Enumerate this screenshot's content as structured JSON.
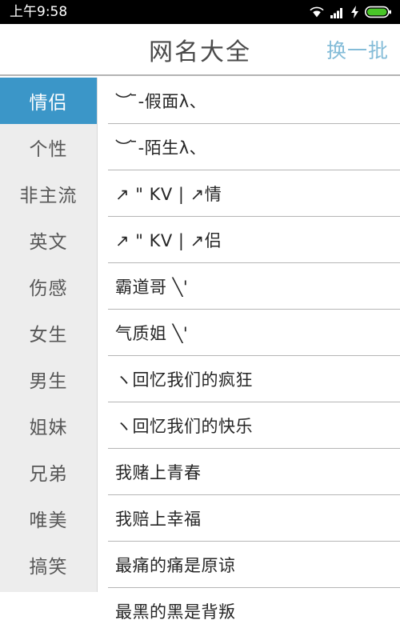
{
  "statusbar": {
    "time": "上午9:58",
    "icons": [
      {
        "name": "wifi-icon"
      },
      {
        "name": "signal-bars-icon"
      },
      {
        "name": "charging-bolt-icon"
      },
      {
        "name": "battery-icon"
      }
    ],
    "battery_color": "#49c628",
    "background": "#000000"
  },
  "header": {
    "title": "网名大全",
    "action_label": "换一批",
    "action_color": "#84bcd8",
    "title_color": "#4a4a4a"
  },
  "sidebar": {
    "active_index": 0,
    "active_bg": "#3b96c8",
    "bg": "#ededed",
    "items": [
      {
        "label": "情侣"
      },
      {
        "label": "个性"
      },
      {
        "label": "非主流"
      },
      {
        "label": "英文"
      },
      {
        "label": "伤感"
      },
      {
        "label": "女生"
      },
      {
        "label": "男生"
      },
      {
        "label": "姐妹"
      },
      {
        "label": "兄弟"
      },
      {
        "label": "唯美"
      },
      {
        "label": "搞笑"
      }
    ]
  },
  "list": {
    "rows": [
      {
        "text": "︶ ̄-假面λ、"
      },
      {
        "text": "︶ ̄-陌生λ、"
      },
      {
        "text": "↗ \" KV | ↗情"
      },
      {
        "text": "↗ \" KV | ↗侣"
      },
      {
        "text": "霸道哥 ╲'"
      },
      {
        "text": "气质姐 ╲'"
      },
      {
        "text": "ヽ回忆我们的疯狂"
      },
      {
        "text": "ヽ回忆我们的快乐"
      },
      {
        "text": "我赌上青春"
      },
      {
        "text": "我赔上幸福"
      },
      {
        "text": "最痛的痛是原谅"
      },
      {
        "text": "最黑的黑是背叛"
      }
    ]
  }
}
